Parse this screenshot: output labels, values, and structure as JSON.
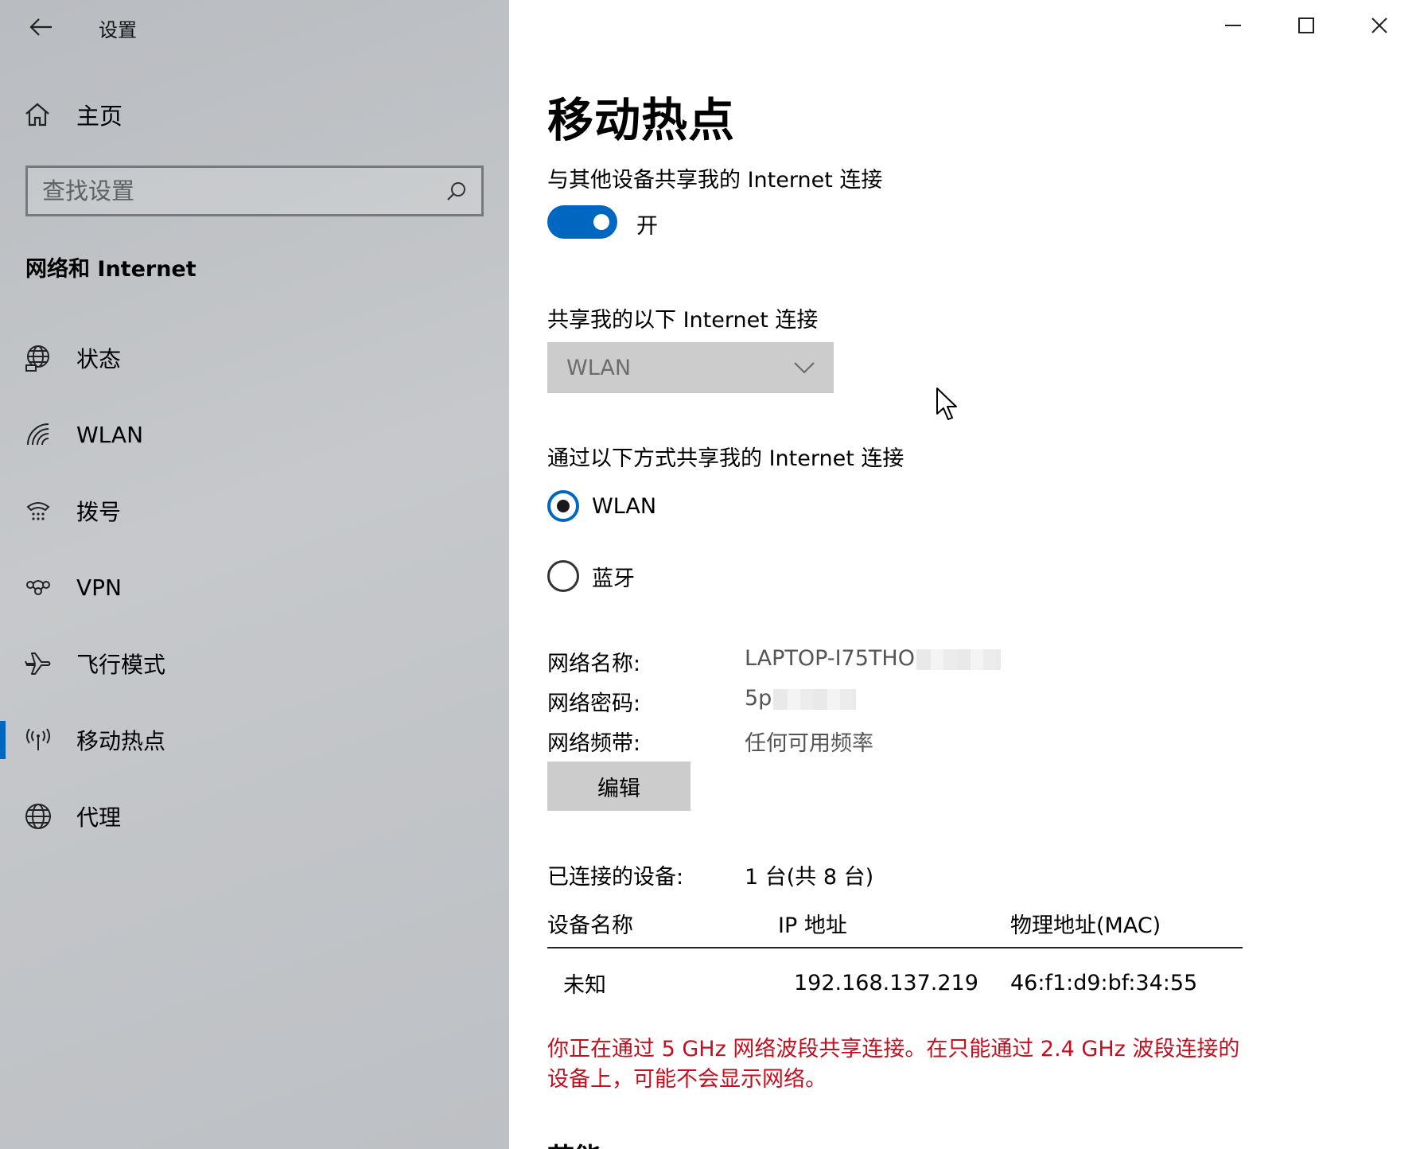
{
  "window": {
    "title": "设置"
  },
  "sidebar": {
    "home_label": "主页",
    "search_placeholder": "查找设置",
    "section_title": "网络和 Internet",
    "items": [
      {
        "label": "状态",
        "icon": "globe-status-icon"
      },
      {
        "label": "WLAN",
        "icon": "wifi-icon"
      },
      {
        "label": "拨号",
        "icon": "dialup-icon"
      },
      {
        "label": "VPN",
        "icon": "vpn-icon"
      },
      {
        "label": "飞行模式",
        "icon": "airplane-icon"
      },
      {
        "label": "移动热点",
        "icon": "hotspot-icon",
        "active": true
      },
      {
        "label": "代理",
        "icon": "globe-icon"
      }
    ]
  },
  "main": {
    "title": "移动热点",
    "share_label": "与其他设备共享我的 Internet 连接",
    "toggle_state": "开",
    "share_from_label": "共享我的以下 Internet 连接",
    "share_from_value": "WLAN",
    "share_over_label": "通过以下方式共享我的 Internet 连接",
    "options": [
      {
        "label": "WLAN",
        "checked": true
      },
      {
        "label": "蓝牙",
        "checked": false
      }
    ],
    "network": {
      "name_label": "网络名称:",
      "name_value": "LAPTOP-I75THO",
      "password_label": "网络密码:",
      "password_value": "5p",
      "band_label": "网络频带:",
      "band_value": "任何可用频率"
    },
    "edit_label": "编辑",
    "devices_label": "已连接的设备:",
    "devices_count": "1 台(共 8 台)",
    "table": {
      "headers": [
        "设备名称",
        "IP 地址",
        "物理地址(MAC)"
      ],
      "rows": [
        {
          "name": "未知",
          "ip": "192.168.137.219",
          "mac": "46:f1:d9:bf:34:55"
        }
      ]
    },
    "warning_line1": "你正在通过 5 GHz 网络波段共享连接。在只能通过 2.4 GHz 波段连接的",
    "warning_line2": "设备上，可能不会显示网络。",
    "next_section": "节能"
  },
  "colors": {
    "accent": "#0067c0",
    "warning": "#c50f1f",
    "sidebar_bg": "#c2c4c7"
  }
}
